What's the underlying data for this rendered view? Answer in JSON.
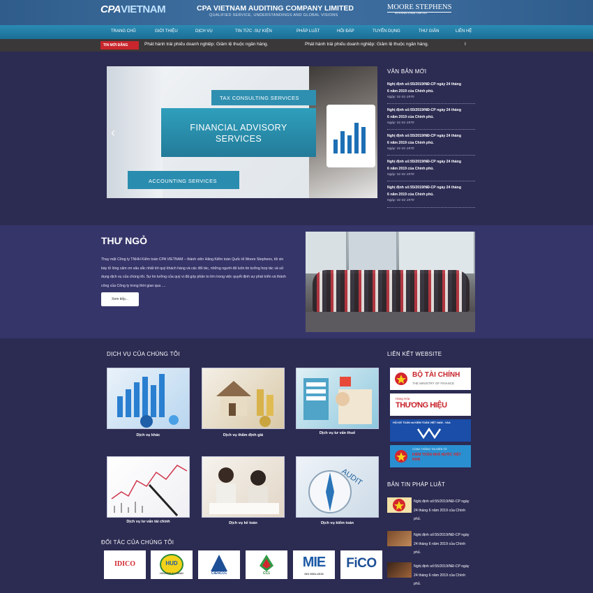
{
  "header": {
    "logo_cpa": "CPA",
    "logo_vn": "VIETNAM",
    "company_name": "CPA VIETNAM AUDITING COMPANY LIMITED",
    "company_tagline": "QUALIFIED SERVICE, UNDERSTANDINGS AND GLOBAL VISIONS",
    "partner_name": "MOORE STEPHENS",
    "partner_sub": "INTERNATIONAL LIMITED"
  },
  "nav": {
    "items": [
      "TRANG CHỦ",
      "GIỚI THIỆU",
      "DỊCH VỤ",
      "TIN TỨC -SỰ KIỆN",
      "PHÁP LUẬT",
      "HỎI ĐÁP",
      "TUYỂN DỤNG",
      "THƯ GIÃN",
      "LIÊN HỆ"
    ]
  },
  "ticker": {
    "badge": "TIN MỚI ĐĂNG",
    "items": [
      "Phát hành trái phiếu doanh nghiệp: Giảm lệ thuộc ngân hàng.",
      "Phát hành trái phiếu doanh nghiệp: Giảm lệ thuộc ngân hàng."
    ],
    "cursor": "I"
  },
  "slider": {
    "panel_tax": "TAX CONSULTING SERVICES",
    "panel_fin_1": "FINANCIAL ADVISORY",
    "panel_fin_2": "SERVICES",
    "panel_acc": "ACCOUNTING SERVICES",
    "prev": "‹",
    "next": "›"
  },
  "new_docs": {
    "title": "VĂN BẢN MỚI",
    "items": [
      {
        "line1": "Nghị định số:55/2019/NĐ-CP ngày 24 tháng",
        "line2": "6 năm 2019 của Chính phủ.",
        "date": "Ngày: 01-01-1970"
      },
      {
        "line1": "Nghị định số:55/2019/NĐ-CP ngày 24 tháng",
        "line2": "6 năm 2019 của Chính phủ.",
        "date": "Ngày: 01-01-1970"
      },
      {
        "line1": "Nghị định số:55/2019/NĐ-CP ngày 24 tháng",
        "line2": "6 năm 2019 của Chính phủ.",
        "date": "Ngày: 01-01-1970"
      },
      {
        "line1": "Nghị định số:55/2019/NĐ-CP ngày 24 tháng",
        "line2": "6 năm 2019 của Chính phủ.",
        "date": "Ngày: 01-01-1970"
      },
      {
        "line1": "Nghị định số:55/2019/NĐ-CP ngày 24 tháng",
        "line2": "6 năm 2019 của Chính phủ.",
        "date": "Ngày: 01-01-1970"
      }
    ]
  },
  "intro": {
    "title": "THƯ NGỎ",
    "text": "Thay mặt Công ty TNHH Kiểm toán CPA VIETNAM – thành viên Hãng Kiểm toán Quốc tế Moore Stephens, tôi xin bày tỏ lòng cảm ơn sâu sắc nhất tới quý khách hàng và các đối tác, những người đã luôn tin tưởng hợp tác và sử dụng dịch vụ của chúng tôi. Sự tin tưởng của quý vị đã góp phần to lớn trong việc quyết định sự phát triển và thành công của Công ty trong thời gian qua ....",
    "more_button": "Xem tiếp..."
  },
  "services": {
    "title": "DỊCH VỤ CỦA CHÚNG TÔI",
    "items": [
      {
        "label": "Dịch vụ khác",
        "icon": "bar-chart-icon"
      },
      {
        "label": "Dịch vụ thẩm định giá",
        "icon": "house-coins-icon"
      },
      {
        "label": "Dịch vụ tư vấn thuế",
        "icon": "tax-papers-icon"
      },
      {
        "label": "Dịch vụ tư vấn tài chính",
        "icon": "stock-chart-icon"
      },
      {
        "label": "Dịch vụ kế toán",
        "icon": "accountants-icon"
      },
      {
        "label": "Dịch vụ kiểm toán",
        "icon": "audit-compass-icon"
      }
    ]
  },
  "partners": {
    "title": "ĐỐI TÁC CỦA CHÚNG TÔI",
    "items": [
      "IDICO",
      "HUD",
      "CIENCO1",
      "CC1",
      "MIE",
      "FiCO"
    ],
    "hud_sub": "HOUSING & URBAN",
    "mie_sub": "ISO 9001:2015"
  },
  "links": {
    "title": "LIÊN KẾT WEBSITE",
    "items": [
      {
        "title": "BỘ TÀI CHÍNH",
        "sub": "THE MINISTRY OF FINANCE"
      },
      {
        "title": "THƯƠNG HIỆU",
        "sub": "Hàng Hóa"
      },
      {
        "title": "HỘI KẾ TOÁN và KIỂM TOÁN VIỆT NAM - VAA",
        "sub": ""
      },
      {
        "title": "KIỂM TOÁN NHÀ NƯỚC VIỆT NAM",
        "sub": "CỔNG THÔNG TIN ĐIỆN TỬ"
      }
    ]
  },
  "legal_news": {
    "title": "BẢN TIN PHÁP LUẬT",
    "items": [
      {
        "l1": "Nghị định số:55/2019/NĐ-CP ngày",
        "l2": "24 tháng 6 năm 2019 của Chính",
        "l3": "phủ."
      },
      {
        "l1": "Nghị định số:55/2019/NĐ-CP ngày",
        "l2": "24 tháng 6 năm 2019 của Chính",
        "l3": "phủ."
      },
      {
        "l1": "Nghị định số:55/2019/NĐ-CP ngày",
        "l2": "24 tháng 6 năm 2019 của Chính",
        "l3": "phủ."
      }
    ]
  },
  "colors": {
    "background": "#2c2b52",
    "band": "#36356a",
    "nav": "#1b6e96",
    "badge": "#c8262c"
  }
}
